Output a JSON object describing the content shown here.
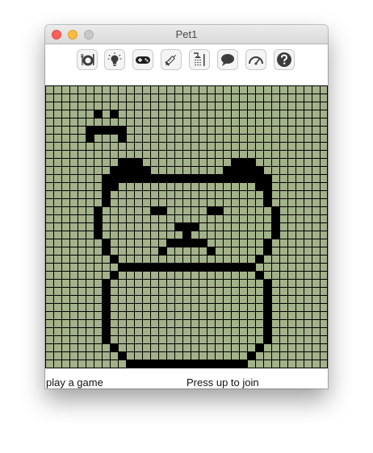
{
  "window": {
    "title": "Pet1"
  },
  "toolbar": {
    "buttons": [
      {
        "name": "feed-button",
        "icon": "fork-plate-icon"
      },
      {
        "name": "light-button",
        "icon": "lightbulb-icon"
      },
      {
        "name": "game-button",
        "icon": "gamepad-icon"
      },
      {
        "name": "medicine-button",
        "icon": "syringe-icon"
      },
      {
        "name": "bath-button",
        "icon": "shower-icon"
      },
      {
        "name": "talk-button",
        "icon": "speech-bubble-icon"
      },
      {
        "name": "stats-button",
        "icon": "gauge-icon"
      },
      {
        "name": "help-button",
        "icon": "question-icon"
      }
    ]
  },
  "screen": {
    "background": "#a3b28a",
    "pixel_color": "#000000",
    "grid_line_color": "#000000"
  },
  "status": {
    "left": "play a game",
    "right": "Press up to join"
  }
}
